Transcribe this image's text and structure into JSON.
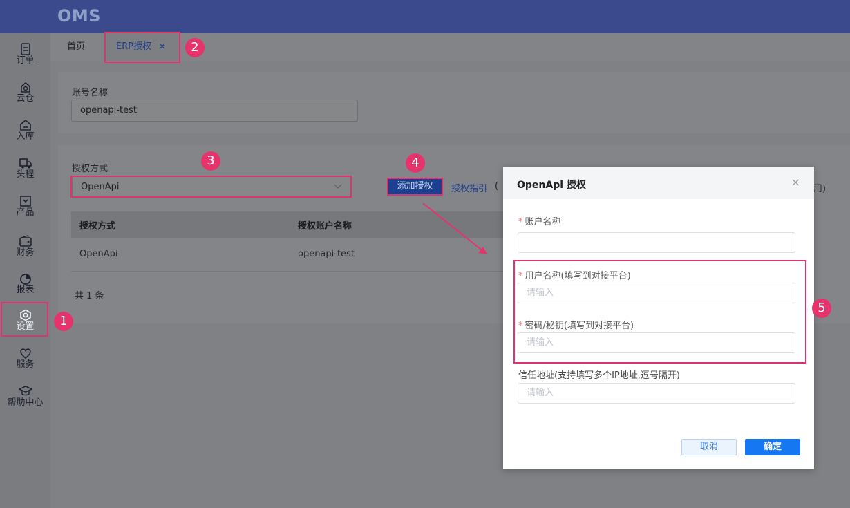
{
  "app": {
    "logo": "OMS"
  },
  "sidebar": {
    "items": [
      {
        "label": "订单",
        "icon": "order-icon"
      },
      {
        "label": "云仓",
        "icon": "cloud-warehouse-icon"
      },
      {
        "label": "入库",
        "icon": "inbound-icon"
      },
      {
        "label": "头程",
        "icon": "truck-icon"
      },
      {
        "label": "产品",
        "icon": "product-icon"
      },
      {
        "label": "财务",
        "icon": "wallet-icon"
      },
      {
        "label": "报表",
        "icon": "pie-chart-icon"
      },
      {
        "label": "设置",
        "icon": "settings-icon",
        "active": true
      },
      {
        "label": "服务",
        "icon": "heart-icon"
      },
      {
        "label": "帮助中心",
        "icon": "graduation-cap-icon"
      }
    ]
  },
  "tabs": {
    "home": "首页",
    "erp": "ERP授权",
    "close": "×"
  },
  "filter": {
    "account_label": "账号名称",
    "account_value": "openapi-test"
  },
  "auth": {
    "method_label": "授权方式",
    "method_value": "OpenApi",
    "add_button": "添加授权",
    "guide_link": "授权指引",
    "guide_paren": "(",
    "trailing_text": "用)"
  },
  "table": {
    "headers": [
      "授权方式",
      "授权账户名称"
    ],
    "rows": [
      [
        "OpenApi",
        "openapi-test"
      ]
    ],
    "total": "共 1 条"
  },
  "modal": {
    "title": "OpenApi 授权",
    "close": "×",
    "fields": [
      {
        "label": "账户名称",
        "required": "*",
        "placeholder": ""
      },
      {
        "label": "用户名称(填写到对接平台)",
        "required": "*",
        "placeholder": "请输入"
      },
      {
        "label": "密码/秘钥(填写到对接平台)",
        "required": "*",
        "placeholder": "请输入"
      },
      {
        "label": "信任地址(支持填写多个IP地址,逗号隔开)",
        "required": "",
        "placeholder": "请输入"
      }
    ],
    "cancel": "取消",
    "confirm": "确定"
  },
  "annotations": {
    "steps": [
      "1",
      "2",
      "3",
      "4",
      "5"
    ],
    "color": "#e5336b"
  }
}
